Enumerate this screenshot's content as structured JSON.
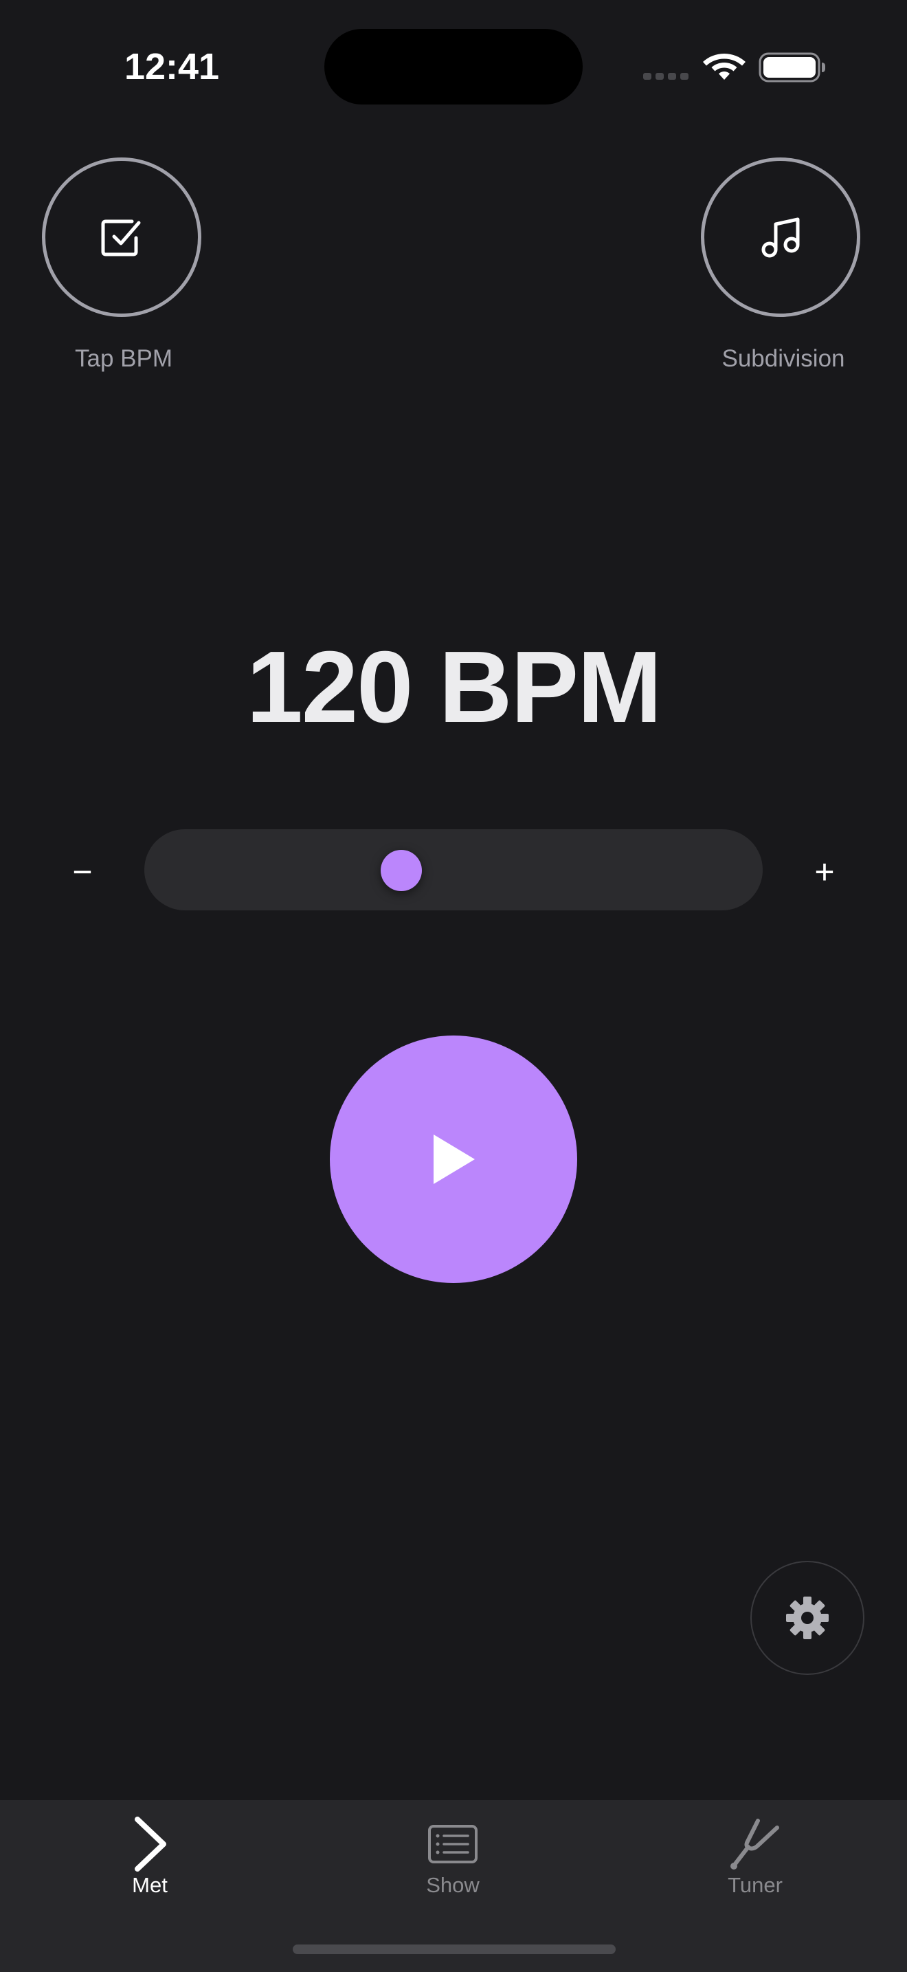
{
  "status_bar": {
    "time": "12:41"
  },
  "top_controls": {
    "tap_bpm_label": "Tap BPM",
    "tap_bpm_icon": "checkbox-icon",
    "subdivision_label": "Subdivision",
    "subdivision_icon": "music-note-icon"
  },
  "tempo": {
    "display": "120 BPM",
    "value": 120,
    "slider_fraction": 0.415,
    "minus_label": "−",
    "plus_label": "+"
  },
  "tab_bar": {
    "tabs": [
      {
        "label": "Met",
        "icon": "chevron-right-icon",
        "active": true
      },
      {
        "label": "Show",
        "icon": "list-icon",
        "active": false
      },
      {
        "label": "Tuner",
        "icon": "tuning-fork-icon",
        "active": false
      }
    ]
  },
  "colors": {
    "accent": "#bb86fc",
    "background": "#18181b",
    "tab_bar": "#27272a",
    "muted_text": "#a1a1aa"
  }
}
